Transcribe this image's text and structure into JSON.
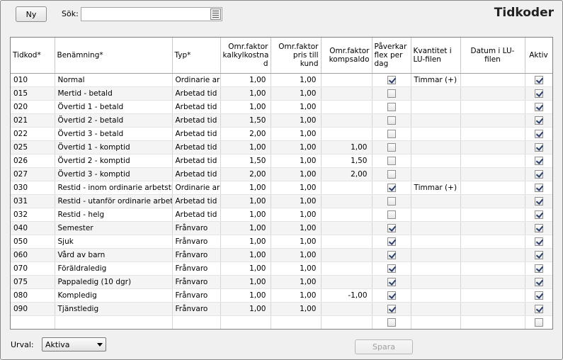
{
  "toolbar": {
    "new_label": "Ny",
    "search_label": "Sök:",
    "search_value": "",
    "search_placeholder": ""
  },
  "page_title": "Tidkoder",
  "columns": [
    "Tidkod*",
    "Benämning*",
    "Typ*",
    "Omr.faktor kalkylkostnad",
    "Omr.faktor pris till kund",
    "Omr.faktor kompsaldo",
    "Påverkar flex per dag",
    "Kvantitet i LU-filen",
    "Datum i LU-filen",
    "Aktiv"
  ],
  "column_headers_display": [
    "Tidkod*",
    "Benämning*",
    "Typ*",
    "Omr.faktor\nkalkylkostna\nd",
    "Omr.faktor\npris till kund",
    "Omr.faktor\nkompsaldo",
    "Påverkar\nflex per\ndag",
    "Kvantitet i\nLU-filen",
    "Datum i LU-filen",
    "Aktiv"
  ],
  "rows": [
    {
      "code": "010",
      "name": "Normal",
      "type": "Ordinarie arb",
      "kalk": "1,00",
      "pris": "1,00",
      "komp": "",
      "flex": true,
      "qty": "Timmar (+)",
      "date": "",
      "active": true
    },
    {
      "code": "015",
      "name": "Mertid - betald",
      "type": "Arbetad tid",
      "kalk": "1,00",
      "pris": "1,00",
      "komp": "",
      "flex": false,
      "qty": "",
      "date": "",
      "active": true
    },
    {
      "code": "020",
      "name": "Övertid 1 - betald",
      "type": "Arbetad tid",
      "kalk": "1,00",
      "pris": "1,00",
      "komp": "",
      "flex": false,
      "qty": "",
      "date": "",
      "active": true
    },
    {
      "code": "021",
      "name": "Övertid 2 - betald",
      "type": "Arbetad tid",
      "kalk": "1,50",
      "pris": "1,00",
      "komp": "",
      "flex": false,
      "qty": "",
      "date": "",
      "active": true
    },
    {
      "code": "022",
      "name": "Övertid 3 - betald",
      "type": "Arbetad tid",
      "kalk": "2,00",
      "pris": "1,00",
      "komp": "",
      "flex": false,
      "qty": "",
      "date": "",
      "active": true
    },
    {
      "code": "025",
      "name": "Övertid 1 - komptid",
      "type": "Arbetad tid",
      "kalk": "1,00",
      "pris": "1,00",
      "komp": "1,00",
      "flex": false,
      "qty": "",
      "date": "",
      "active": true
    },
    {
      "code": "026",
      "name": "Övertid 2 - komptid",
      "type": "Arbetad tid",
      "kalk": "1,50",
      "pris": "1,00",
      "komp": "1,50",
      "flex": false,
      "qty": "",
      "date": "",
      "active": true
    },
    {
      "code": "027",
      "name": "Övertid 3 - komptid",
      "type": "Arbetad tid",
      "kalk": "2,00",
      "pris": "1,00",
      "komp": "2,00",
      "flex": false,
      "qty": "",
      "date": "",
      "active": true
    },
    {
      "code": "030",
      "name": "Restid - inom ordinarie arbetstid",
      "type": "Ordinarie arb",
      "kalk": "1,00",
      "pris": "1,00",
      "komp": "",
      "flex": true,
      "qty": "Timmar (+)",
      "date": "",
      "active": true
    },
    {
      "code": "031",
      "name": "Restid - utanför ordinarie arbetst",
      "type": "Arbetad tid",
      "kalk": "1,00",
      "pris": "1,00",
      "komp": "",
      "flex": false,
      "qty": "",
      "date": "",
      "active": true
    },
    {
      "code": "032",
      "name": "Restid - helg",
      "type": "Arbetad tid",
      "kalk": "1,00",
      "pris": "1,00",
      "komp": "",
      "flex": false,
      "qty": "",
      "date": "",
      "active": true
    },
    {
      "code": "040",
      "name": "Semester",
      "type": "Frånvaro",
      "kalk": "1,00",
      "pris": "1,00",
      "komp": "",
      "flex": true,
      "qty": "",
      "date": "",
      "active": true
    },
    {
      "code": "050",
      "name": "Sjuk",
      "type": "Frånvaro",
      "kalk": "1,00",
      "pris": "1,00",
      "komp": "",
      "flex": true,
      "qty": "",
      "date": "",
      "active": true
    },
    {
      "code": "060",
      "name": "Vård av barn",
      "type": "Frånvaro",
      "kalk": "1,00",
      "pris": "1,00",
      "komp": "",
      "flex": true,
      "qty": "",
      "date": "",
      "active": true
    },
    {
      "code": "070",
      "name": "Föräldraledig",
      "type": "Frånvaro",
      "kalk": "1,00",
      "pris": "1,00",
      "komp": "",
      "flex": true,
      "qty": "",
      "date": "",
      "active": true
    },
    {
      "code": "075",
      "name": "Pappaledig (10 dgr)",
      "type": "Frånvaro",
      "kalk": "1,00",
      "pris": "1,00",
      "komp": "",
      "flex": true,
      "qty": "",
      "date": "",
      "active": true
    },
    {
      "code": "080",
      "name": "Kompledig",
      "type": "Frånvaro",
      "kalk": "1,00",
      "pris": "1,00",
      "komp": "-1,00",
      "flex": true,
      "qty": "",
      "date": "",
      "active": true
    },
    {
      "code": "090",
      "name": "Tjänstledig",
      "type": "Frånvaro",
      "kalk": "1,00",
      "pris": "1,00",
      "komp": "",
      "flex": true,
      "qty": "",
      "date": "",
      "active": true
    },
    {
      "code": "",
      "name": "",
      "type": "",
      "kalk": "",
      "pris": "",
      "komp": "",
      "flex": false,
      "qty": "",
      "date": "",
      "active": false
    }
  ],
  "footer": {
    "filter_label": "Urval:",
    "filter_value": "Aktiva",
    "save_label": "Spara"
  }
}
